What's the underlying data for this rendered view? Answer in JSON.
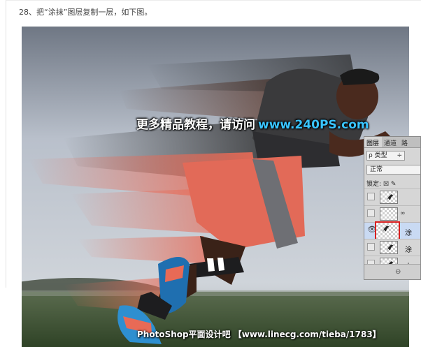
{
  "page": {
    "caption": "28、把“涂抹”图层复制一层，如下图。"
  },
  "image": {
    "watermark_main": "更多精品教程，请访问",
    "watermark_url": "www.240PS.com",
    "footer_credit": "PhotoShop平面设计吧 【www.linecg.com/tieba/1783】"
  },
  "layers_panel": {
    "tabs": [
      "图层",
      "通道",
      "路"
    ],
    "filter_label": "ρ 类型",
    "filter_caret": "÷",
    "blend_mode": "正常",
    "lock_label": "锁定: ☒ ✎",
    "layers": [
      {
        "name": "",
        "visible": false,
        "selected": false,
        "has_figure": true,
        "linked": false
      },
      {
        "name": "",
        "visible": false,
        "selected": false,
        "has_figure": false,
        "linked": true
      },
      {
        "name": "涂",
        "visible": true,
        "selected": true,
        "has_figure": true,
        "linked": false
      },
      {
        "name": "涂",
        "visible": false,
        "selected": false,
        "has_figure": true,
        "linked": false
      },
      {
        "name": "人",
        "visible": false,
        "selected": false,
        "has_figure": true,
        "linked": false
      }
    ],
    "link_icon": "⊖"
  },
  "colors": {
    "watermark_url": "#39c4ff",
    "selection_outline": "#d82020",
    "selected_row": "#c9daf3"
  }
}
